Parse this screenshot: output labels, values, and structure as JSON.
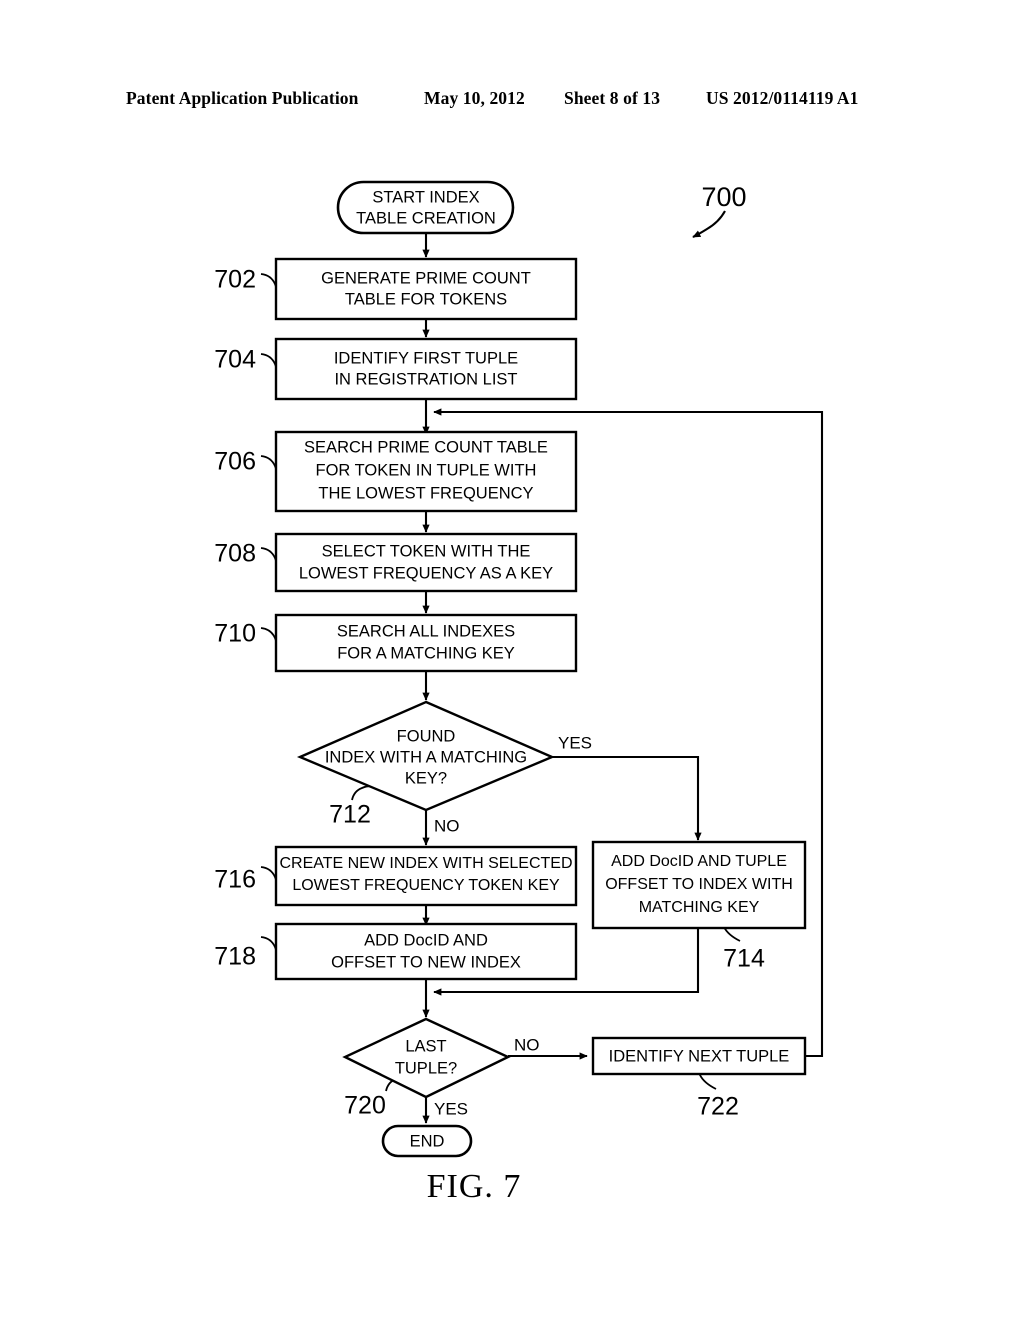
{
  "header": {
    "publication": "Patent Application Publication",
    "date": "May 10, 2012",
    "sheet": "Sheet 8 of 13",
    "number": "US 2012/0114119 A1"
  },
  "figure": {
    "caption_prefix": "FIG.",
    "caption_number": "7",
    "diagram_ref": "700"
  },
  "nodes": {
    "start": {
      "ref": "",
      "line1": "START INDEX",
      "line2": "TABLE CREATION"
    },
    "n702": {
      "ref": "702",
      "line1": "GENERATE PRIME COUNT",
      "line2": "TABLE FOR TOKENS"
    },
    "n704": {
      "ref": "704",
      "line1": "IDENTIFY FIRST TUPLE",
      "line2": "IN REGISTRATION LIST"
    },
    "n706": {
      "ref": "706",
      "line1": "SEARCH PRIME COUNT TABLE",
      "line2": "FOR TOKEN IN TUPLE WITH",
      "line3": "THE LOWEST FREQUENCY"
    },
    "n708": {
      "ref": "708",
      "line1": "SELECT TOKEN WITH THE",
      "line2": "LOWEST FREQUENCY AS A KEY"
    },
    "n710": {
      "ref": "710",
      "line1": "SEARCH ALL INDEXES",
      "line2": "FOR A MATCHING KEY"
    },
    "n712": {
      "ref": "712",
      "line1": "FOUND",
      "line2": "INDEX WITH A MATCHING",
      "line3": "KEY?",
      "branch_yes": "YES",
      "branch_no": "NO"
    },
    "n714": {
      "ref": "714",
      "line1": "ADD DocID AND TUPLE",
      "line2": "OFFSET TO INDEX WITH",
      "line3": "MATCHING KEY"
    },
    "n716": {
      "ref": "716",
      "line1": "CREATE NEW INDEX WITH SELECTED",
      "line2": "LOWEST FREQUENCY TOKEN KEY"
    },
    "n718": {
      "ref": "718",
      "line1": "ADD DocID AND",
      "line2": "OFFSET TO NEW INDEX"
    },
    "n720": {
      "ref": "720",
      "line1": "LAST",
      "line2": "TUPLE?",
      "branch_yes": "YES",
      "branch_no": "NO"
    },
    "n722": {
      "ref": "722",
      "line1": "IDENTIFY NEXT TUPLE"
    },
    "end": {
      "ref": "",
      "line1": "END"
    }
  }
}
